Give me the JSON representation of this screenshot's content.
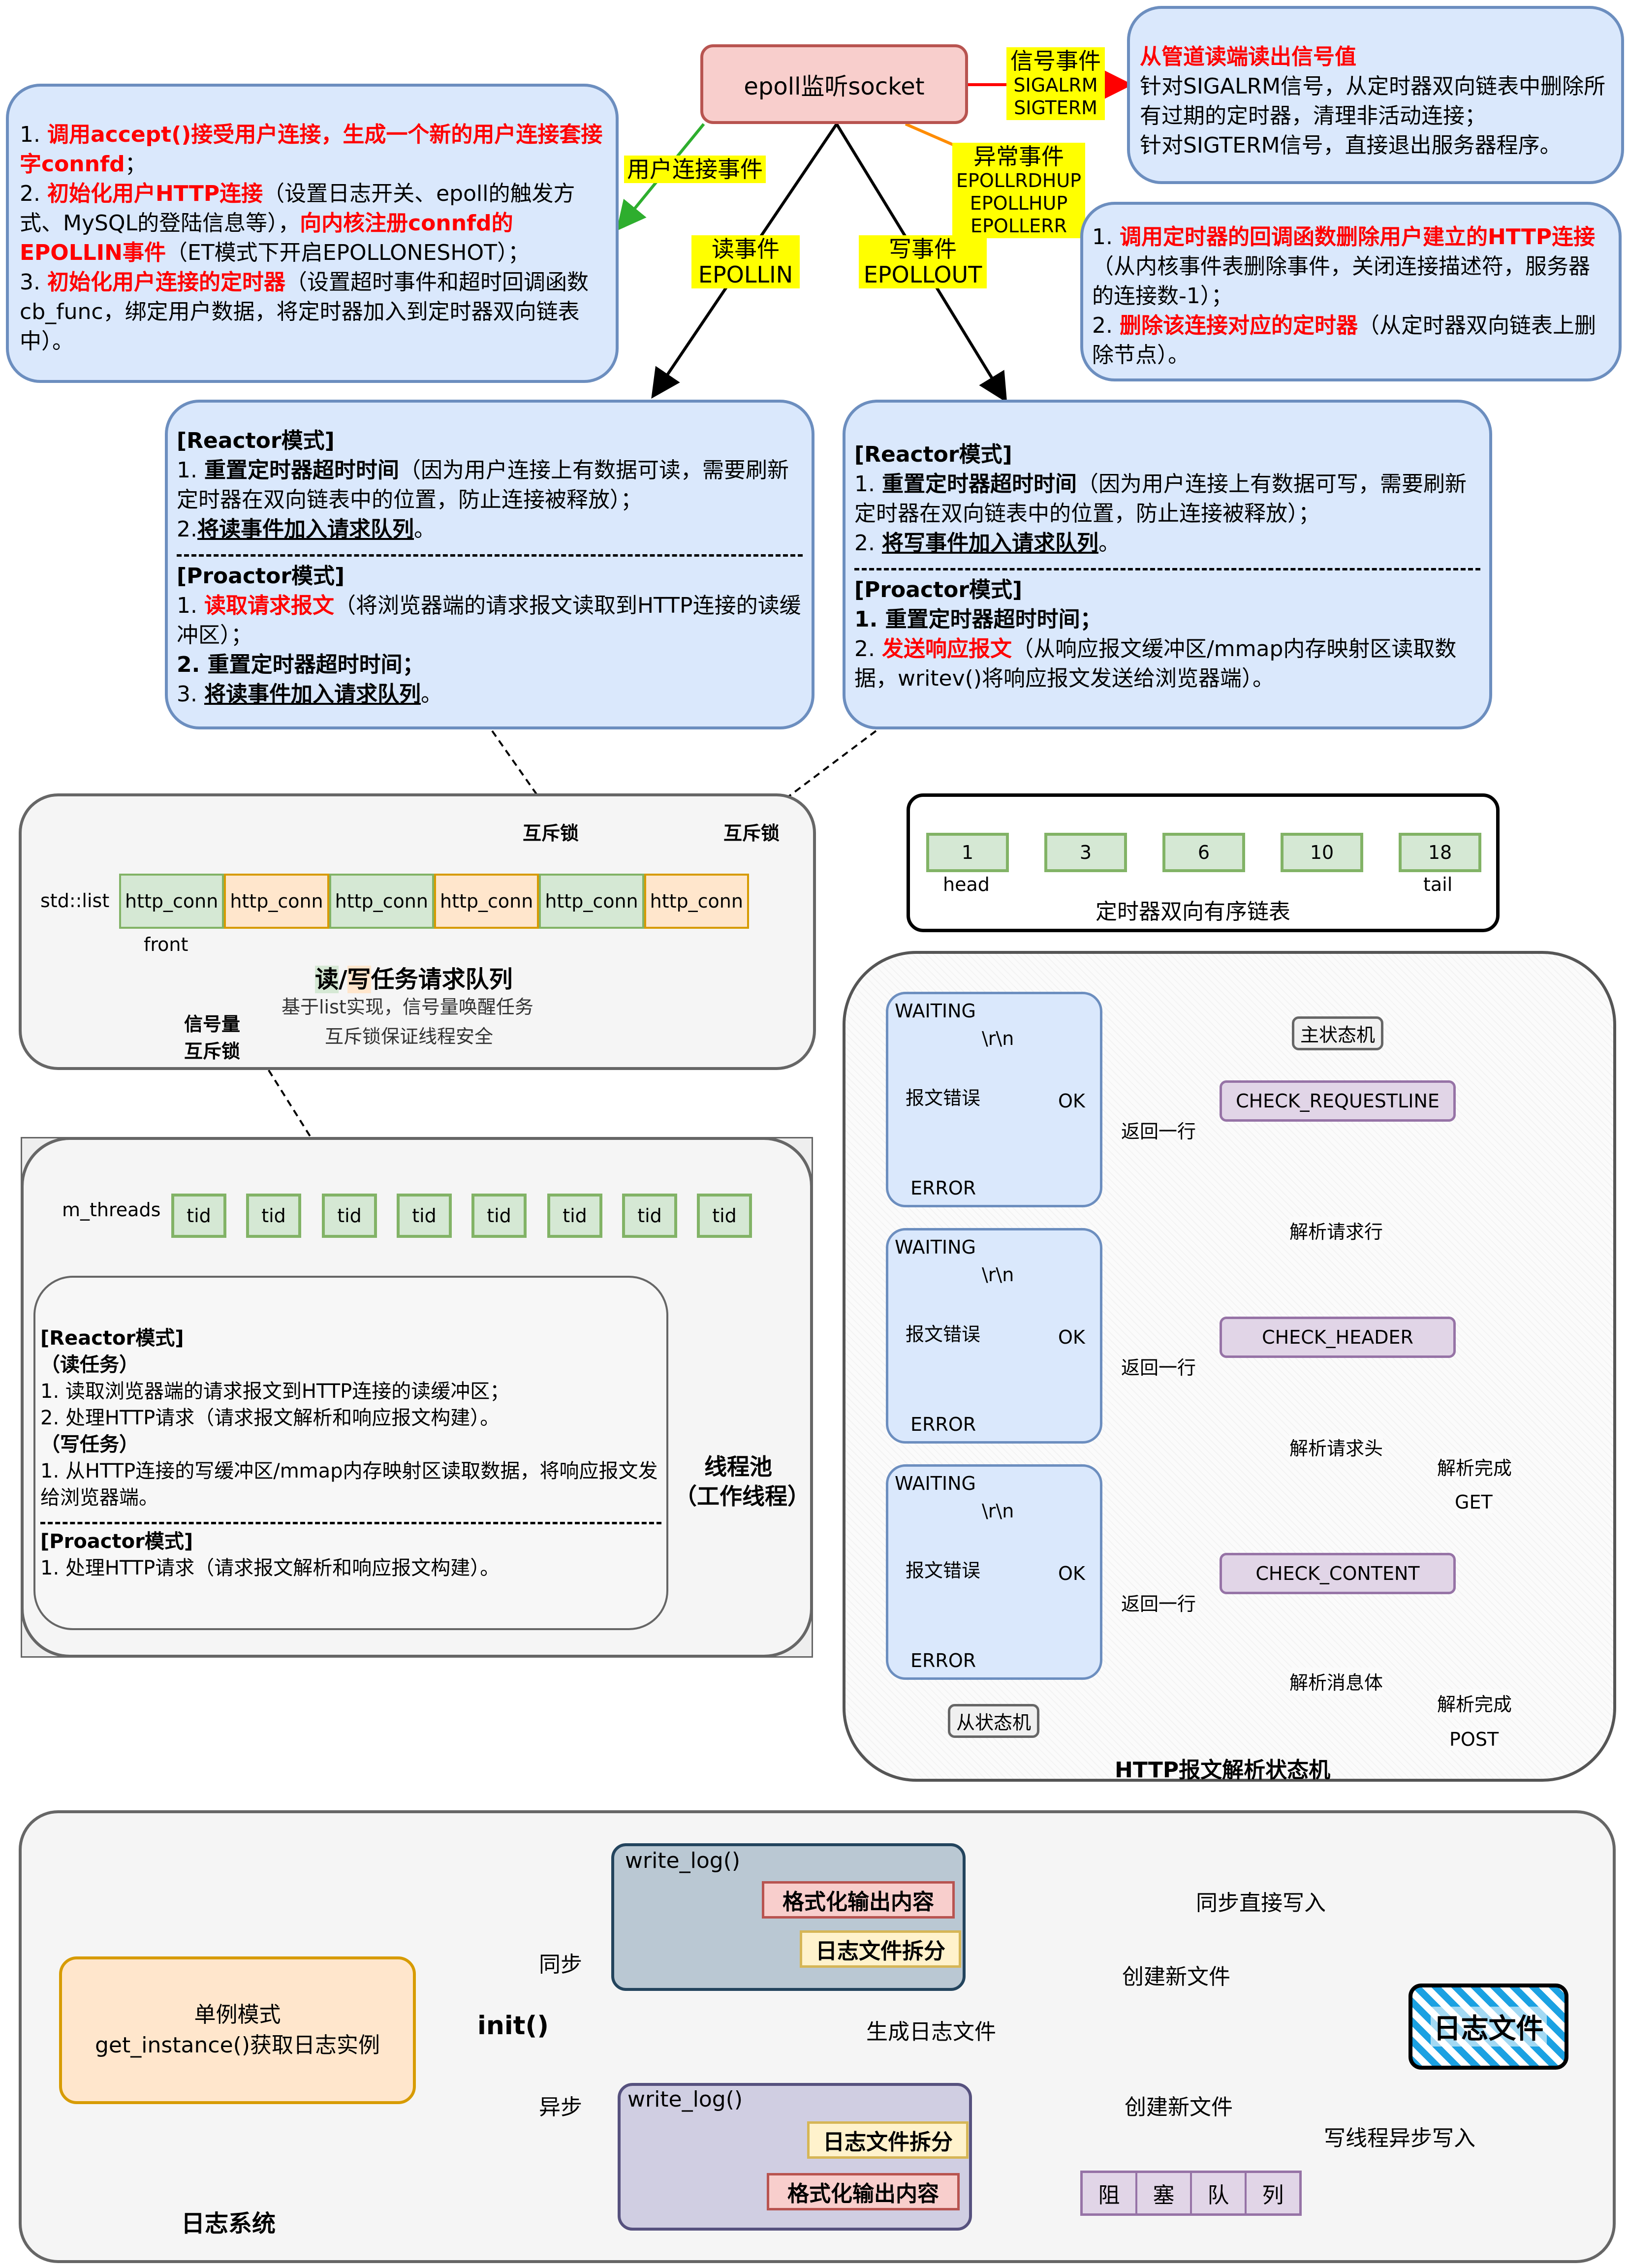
{
  "epoll": {
    "title": "epoll监听socket",
    "signal_label": "信号事件",
    "signal_sub1": "SIGALRM",
    "signal_sub2": "SIGTERM",
    "exception_label": "异常事件",
    "exception_sub1": "EPOLLRDHUP",
    "exception_sub2": "EPOLLHUP",
    "exception_sub3": "EPOLLERR",
    "user_conn_label": "用户连接事件",
    "read_label": "读事件",
    "read_sub": "EPOLLIN",
    "write_label": "写事件",
    "write_sub": "EPOLLOUT"
  },
  "signal_box": {
    "title": "从管道读端读出信号值",
    "line1": "针对SIGALRM信号，从定时器双向链表中删除所有过期的定时器，清理非活动连接；",
    "line2": "针对SIGTERM信号，直接退出服务器程序。"
  },
  "accept_box": {
    "p1_num": "1. ",
    "p1_red": "调用accept()接受用户连接，生成一个新的用户连接套接字connfd",
    "p1_tail": "；",
    "p2_num": "2. ",
    "p2_red": "初始化用户HTTP连接",
    "p2_mid": "（设置日志开关、epoll的触发方式、MySQL的登陆信息等），",
    "p2_red2": "向内核注册connfd的EPOLLIN事件",
    "p2_tail": "（ET模式下开启EPOLLONESHOT）；",
    "p3_num": "3. ",
    "p3_red": "初始化用户连接的定时器",
    "p3_tail": "（设置超时事件和超时回调函数cb_func，绑定用户数据，将定时器加入到定时器双向链表中）。"
  },
  "exception_box": {
    "p1_num": "1. ",
    "p1_red": "调用定时器的回调函数删除用户建立的HTTP连接",
    "p1_tail": "（从内核事件表删除事件，关闭连接描述符，服务器的连接数-1）；",
    "p2_num": "2. ",
    "p2_red": "删除该连接对应的定时器",
    "p2_tail": "（从定时器双向链表上删除节点）。"
  },
  "read_box": {
    "reactor_title": "[Reactor模式]",
    "r1_num": "1. ",
    "r1_bold": "重置定时器超时时间",
    "r1_tail": "（因为用户连接上有数据可读，需要刷新定时器在双向链表中的位置，防止连接被释放）；",
    "r2_num": "2.",
    "r2_bold": "将读事件加入请求队列",
    "r2_tail": "。",
    "proactor_title": "[Proactor模式]",
    "p1_num": "1. ",
    "p1_red": "读取请求报文",
    "p1_tail": "（将浏览器端的请求报文读取到HTTP连接的读缓冲区）；",
    "p2": "2. 重置定时器超时时间；",
    "p3_num": "3. ",
    "p3_bold": "将读事件加入请求队列",
    "p3_tail": "。"
  },
  "write_box": {
    "reactor_title": "[Reactor模式]",
    "r1_num": "1. ",
    "r1_bold": "重置定时器超时时间",
    "r1_tail": "（因为用户连接上有数据可写，需要刷新定时器在双向链表中的位置，防止连接被释放）；",
    "r2_num": "2. ",
    "r2_bold": "将写事件加入请求队列",
    "r2_tail": "。",
    "proactor_title": "[Proactor模式]",
    "p1": "1. 重置定时器超时时间；",
    "p2_num": "2. ",
    "p2_red": "发送响应报文",
    "p2_tail": "（从响应报文缓冲区/mmap内存映射区读取数据，writev()将响应报文发送给浏览器端）。"
  },
  "queue": {
    "mutex1": "互斥锁",
    "mutex2": "互斥锁",
    "list_label": "std::list",
    "cells": [
      "http_conn",
      "http_conn",
      "http_conn",
      "http_conn",
      "http_conn",
      "http_conn"
    ],
    "front": "front",
    "title_read": "读",
    "title_slash": "/",
    "title_write": "写",
    "title_rest": "任务请求队列",
    "desc1": "基于list实现，信号量唤醒任务",
    "desc2": "互斥锁保证线程安全",
    "sem1": "信号量",
    "sem2": "互斥锁"
  },
  "timer_list": {
    "nodes": [
      "1",
      "3",
      "6",
      "10",
      "18"
    ],
    "head": "head",
    "tail": "tail",
    "caption": "定时器双向有序链表"
  },
  "threadpool": {
    "label": "m_threads",
    "tids": [
      "tid",
      "tid",
      "tid",
      "tid",
      "tid",
      "tid",
      "tid",
      "tid"
    ],
    "reactor_title": "[Reactor模式]",
    "read_task": "（读任务）",
    "r1": "1. 读取浏览器端的请求报文到HTTP连接的读缓冲区；",
    "r2": "2. 处理HTTP请求（请求报文解析和响应报文构建）。",
    "write_task": "（写任务）",
    "w1": "1. 从HTTP连接的写缓冲区/mmap内存映射区读取数据，将响应报文发给浏览器端。",
    "proactor_title": "[Proactor模式]",
    "p1": "1. 处理HTTP请求（请求报文解析和响应报文构建）。",
    "name1": "线程池",
    "name2": "（工作线程）"
  },
  "fsm": {
    "waiting": "WAITING",
    "rn": "\\r\\n",
    "err_msg": "报文错误",
    "ok": "OK",
    "error": "ERROR",
    "main_tag": "主状态机",
    "sub_tag": "从状态机",
    "states": [
      "CHECK_REQUESTLINE",
      "CHECK_HEADER",
      "CHECK_CONTENT"
    ],
    "return_line": "返回一行",
    "parse_reqline": "解析请求行",
    "parse_header": "解析请求头",
    "parse_body": "解析消息体",
    "parse_done": "解析完成",
    "get": "GET",
    "post": "POST",
    "title": "HTTP报文解析状态机"
  },
  "log": {
    "singleton1": "单例模式",
    "singleton2": "get_instance()获取日志实例",
    "init": "init()",
    "sync": "同步",
    "async": "异步",
    "write_log": "write_log()",
    "format": "格式化输出内容",
    "split": "日志文件拆分",
    "sync_write": "同步直接写入",
    "create_new": "创建新文件",
    "gen_file": "生成日志文件",
    "log_file": "日志文件",
    "async_write": "写线程异步写入",
    "queue": [
      "阻",
      "塞",
      "队",
      "列"
    ],
    "title": "日志系统"
  }
}
